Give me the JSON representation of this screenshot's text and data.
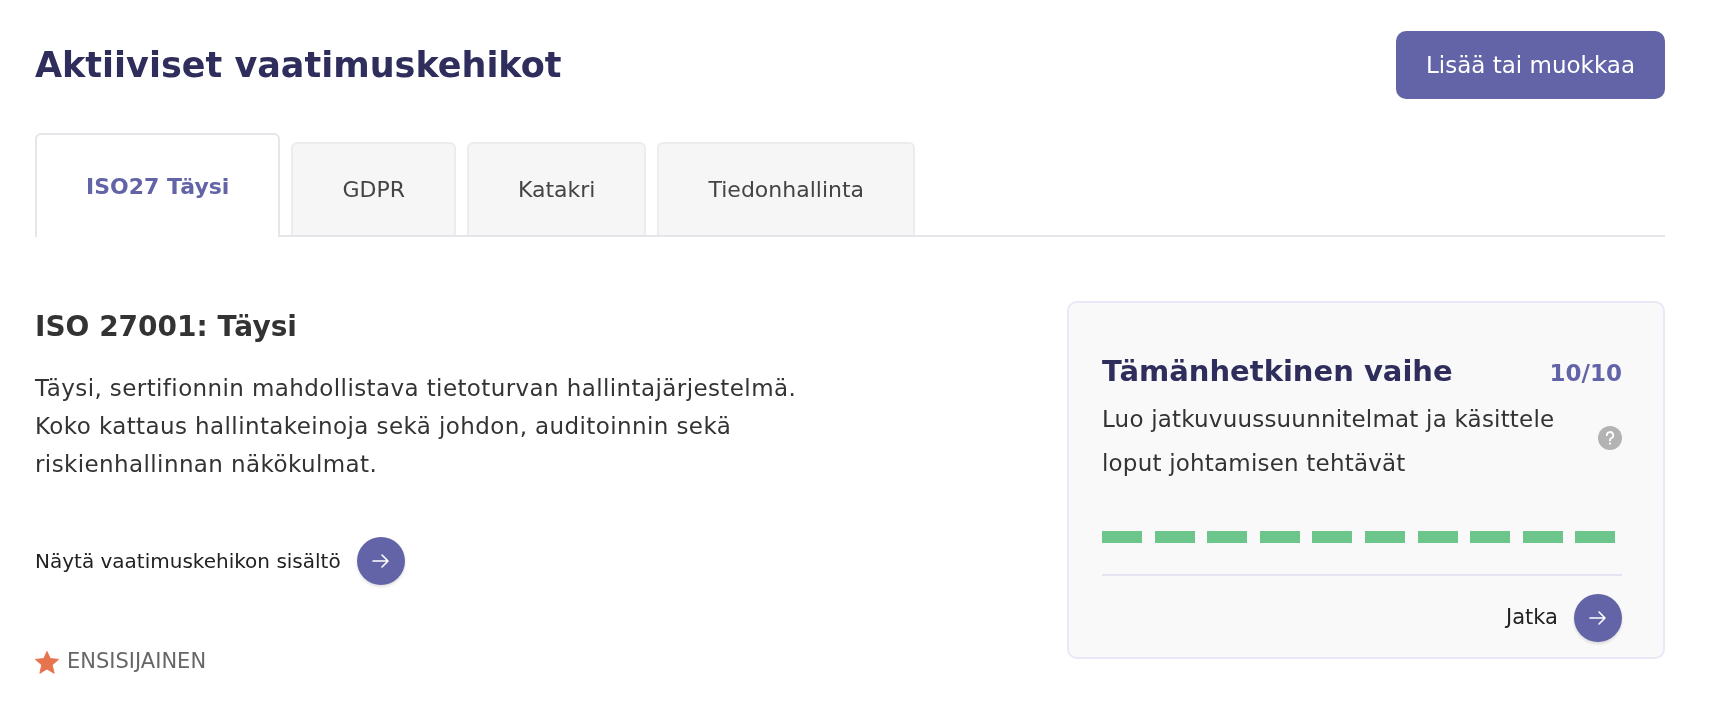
{
  "header": {
    "title": "Aktiiviset vaatimuskehikot",
    "button": "Lisää tai muokkaa"
  },
  "tabs": [
    {
      "label": "ISO27 Täysi",
      "selected": true
    },
    {
      "label": "GDPR",
      "selected": false
    },
    {
      "label": "Katakri",
      "selected": false
    },
    {
      "label": "Tiedonhallinta",
      "selected": false
    }
  ],
  "framework": {
    "title": "ISO 27001: Täysi",
    "description": "Täysi, sertifionnin mahdollistava tietoturvan hallintajärjestelmä. Koko kattaus hallintakeinoja sekä johdon, auditoinnin sekä riskienhallinnan näkökulmat.",
    "link": "Näytä vaatimuskehikon sisältö",
    "priority": "ENSISIJAINEN"
  },
  "current_phase": {
    "title": "Tämänhetkinen vaihe",
    "count": "10/10",
    "description": "Luo jatkuvuussuunnitelmat ja käsittele loput johtamisen tehtävät",
    "steps": [
      {
        "completed": true
      },
      {
        "completed": true
      },
      {
        "completed": true
      },
      {
        "completed": true
      },
      {
        "completed": true
      },
      {
        "completed": true
      },
      {
        "completed": true
      },
      {
        "completed": true
      },
      {
        "completed": true
      },
      {
        "completed": true
      }
    ],
    "action": "Jatka"
  }
}
